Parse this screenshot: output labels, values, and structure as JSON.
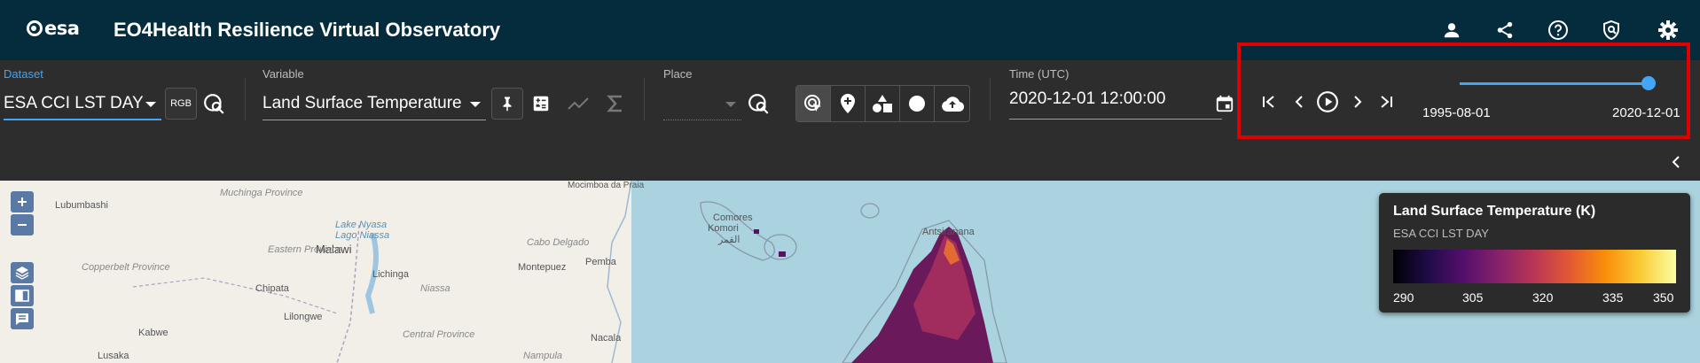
{
  "app": {
    "logo_text": "esa",
    "title": "EO4Health Resilience Virtual Observatory"
  },
  "top_icons": [
    "user-icon",
    "share-icon",
    "help-icon",
    "privacy-icon",
    "settings-icon"
  ],
  "dataset": {
    "label": "Dataset",
    "value": "ESA CCI LST DAY",
    "rgb_label": "RGB"
  },
  "variable": {
    "label": "Variable",
    "value": "Land Surface Temperature"
  },
  "place": {
    "label": "Place",
    "value": ""
  },
  "time": {
    "label": "Time (UTC)",
    "value": "2020-12-01 12:00:00"
  },
  "time_slider": {
    "start": "1995-08-01",
    "end": "2020-12-01",
    "position": 1.0
  },
  "map": {
    "places": [
      "Lubumbashi",
      "Muchinga Province",
      "Malawi",
      "Copperbelt Province",
      "Eastern Province",
      "Central Province",
      "Chipata",
      "Lilongwe",
      "Kabwe",
      "Lusaka",
      "Lichinga",
      "Niassa",
      "Cabo Delgado",
      "Montepuez",
      "Pemba",
      "Nacala",
      "Nampula",
      "Mocimboa da Praia",
      "Comores",
      "Komori",
      "القمر",
      "Antsiranana",
      "Lake Nyasa",
      "Lago Niassa"
    ]
  },
  "legend": {
    "title": "Land Surface Temperature (K)",
    "subtitle": "ESA CCI LST DAY",
    "ticks": [
      "290",
      "305",
      "320",
      "335",
      "350"
    ]
  },
  "colors": {
    "appbar": "#042c3d",
    "accent": "#42a5f5",
    "highlight": "#e00000"
  }
}
